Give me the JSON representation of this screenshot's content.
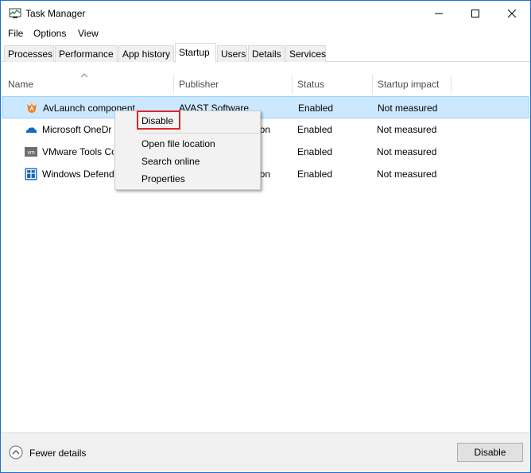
{
  "window": {
    "title": "Task Manager"
  },
  "menubar": [
    "File",
    "Options",
    "View"
  ],
  "tabs": [
    "Processes",
    "Performance",
    "App history",
    "Startup",
    "Users",
    "Details",
    "Services"
  ],
  "columns": {
    "name": "Name",
    "publisher": "Publisher",
    "status": "Status",
    "impact": "Startup impact"
  },
  "rows": [
    {
      "name": "AvLaunch component",
      "publisher": "AVAST Software",
      "status": "Enabled",
      "impact": "Not measured",
      "icon": "avast-icon"
    },
    {
      "name": "Microsoft OneDr",
      "publisher": "ion",
      "status": "Enabled",
      "impact": "Not measured",
      "icon": "onedrive-icon"
    },
    {
      "name": "VMware Tools Co",
      "publisher": "",
      "status": "Enabled",
      "impact": "Not measured",
      "icon": "vmware-icon"
    },
    {
      "name": "Windows Defend",
      "publisher": "ion",
      "status": "Enabled",
      "impact": "Not measured",
      "icon": "windows-defender-icon"
    }
  ],
  "context_menu": {
    "disable": "Disable",
    "open_location": "Open file location",
    "search_online": "Search online",
    "properties": "Properties"
  },
  "footer": {
    "fewer_details": "Fewer details",
    "disable_button": "Disable"
  },
  "colors": {
    "selection": "#cce8ff",
    "highlight": "#e0262b",
    "avast": "#f27b1b",
    "onedrive": "#0f6cbd"
  }
}
